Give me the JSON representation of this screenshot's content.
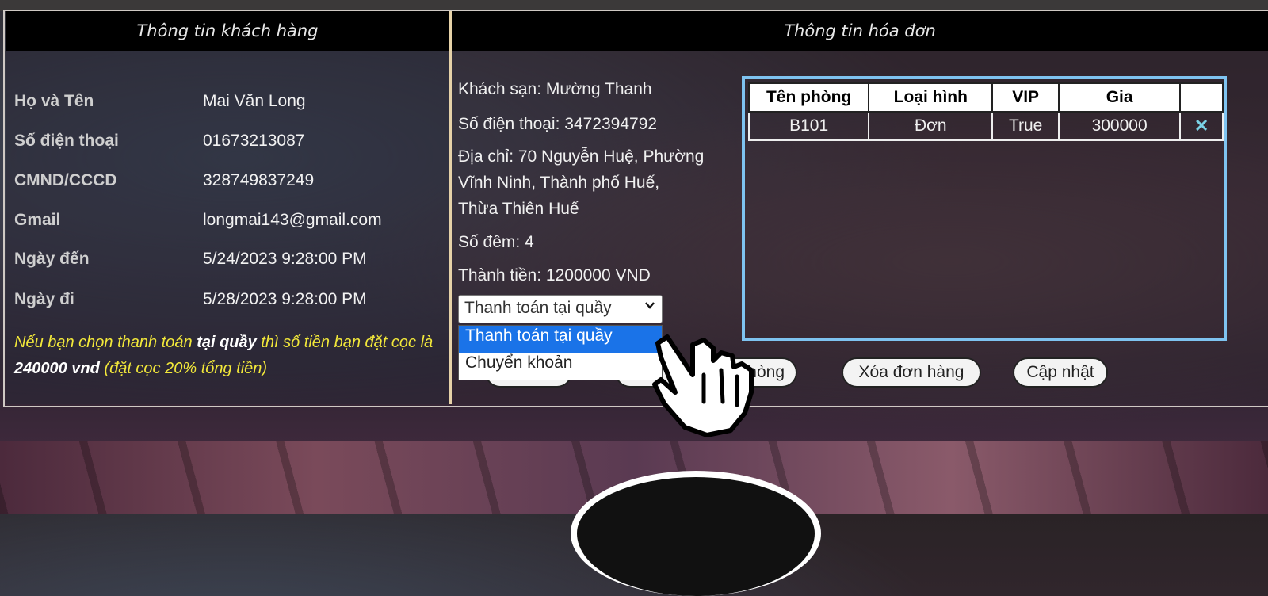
{
  "left_panel": {
    "title": "Thông tin khách hàng",
    "fields": [
      {
        "label": "Họ và Tên",
        "value": "Mai Văn Long"
      },
      {
        "label": "Số điện thoại",
        "value": "01673213087"
      },
      {
        "label": "CMND/CCCD",
        "value": "328749837249"
      },
      {
        "label": "Gmail",
        "value": "longmai143@gmail.com"
      },
      {
        "label": "Ngày đến",
        "value": "5/24/2023 9:28:00 PM"
      },
      {
        "label": "Ngày đi",
        "value": "5/28/2023 9:28:00 PM"
      }
    ],
    "note": {
      "part1": "Nếu bạn chọn thanh toán ",
      "bold1": "tại quầy",
      "part2": " thì số tiền bạn đặt cọc là ",
      "bold2": "240000 vnd",
      "part3": " (đặt cọc 20% tổng tiền)"
    }
  },
  "right_panel": {
    "title": "Thông tin hóa đơn",
    "hotel": "Khách sạn: Mường Thanh",
    "phone": "Số điện thoại: 3472394792",
    "address_lines": [
      "Địa chỉ: 70 Nguyễn Huệ, Phường",
      "Vĩnh Ninh, Thành phố Huế,",
      "Thừa Thiên Huế"
    ],
    "nights": "Số đêm: 4",
    "total": "Thành tiền: 1200000 VND",
    "payment_select": {
      "selected": "Thanh toán tại quầy",
      "options": [
        "Thanh toán tại quầy",
        "Chuyển khoản"
      ]
    },
    "buttons": {
      "partial_hidden_1": "",
      "partial_hidden_2": "",
      "partial_room": "hòng",
      "delete_order": "Xóa đơn hàng",
      "update": "Cập nhật"
    },
    "table": {
      "headers": [
        "Tên phòng",
        "Loại hình",
        "VIP",
        "Gia",
        ""
      ],
      "rows": [
        {
          "room": "B101",
          "type": "Đơn",
          "vip": "True",
          "price": "300000",
          "action": "✕"
        }
      ]
    }
  },
  "colors": {
    "accent_border": "#7ec3f0",
    "note_yellow": "#f2e83a",
    "selected_option": "#1a73e8"
  }
}
